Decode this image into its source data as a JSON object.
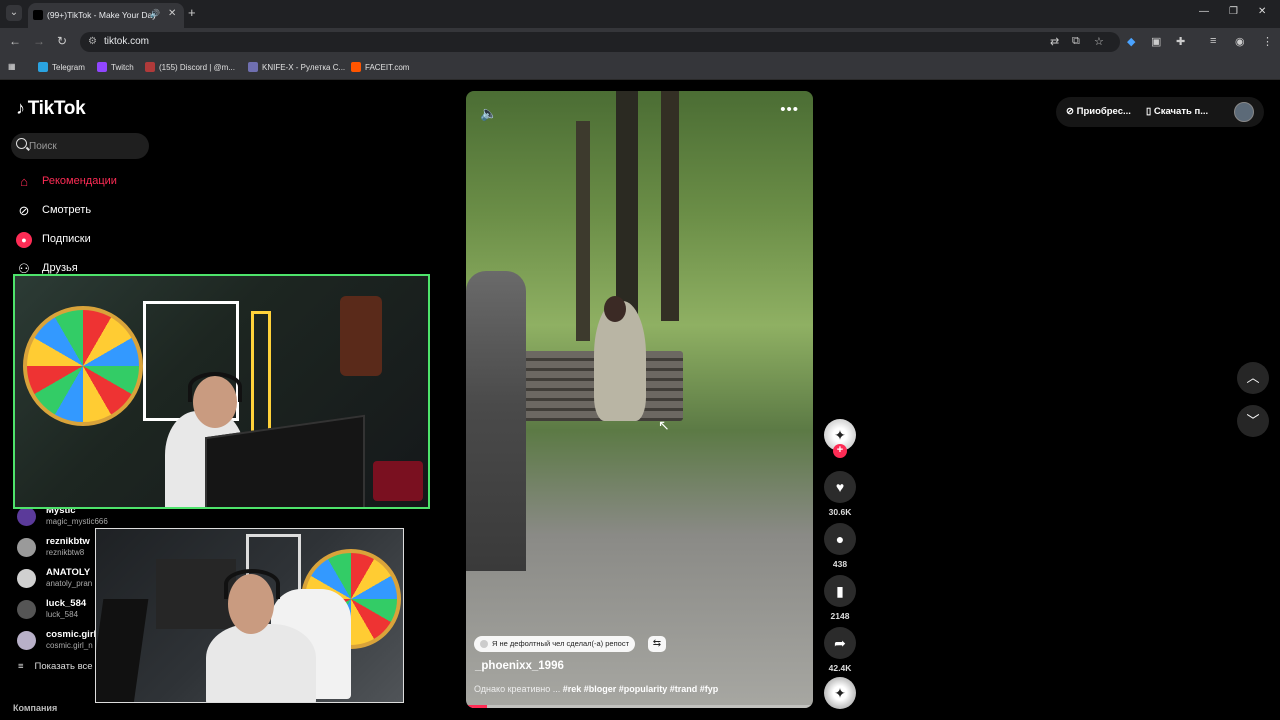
{
  "browser": {
    "tab_title": "(99+)TikTok - Make Your Day",
    "url": "tiktok.com",
    "bookmarks": [
      "Telegram",
      "Twitch",
      "(155) Discord | @m...",
      "KNIFE-X - Рулетка С...",
      "FACEIT.com"
    ],
    "bookmark_colors": [
      "#2aa3e0",
      "#9146ff",
      "#b03a3a",
      "#6f6fb0",
      "#ff5500"
    ]
  },
  "tiktok": {
    "logo": "TikTok",
    "search_placeholder": "Поиск",
    "nav": [
      {
        "label": "Рекомендации",
        "icon": "home-icon"
      },
      {
        "label": "Смотреть",
        "icon": "compass-icon"
      },
      {
        "label": "Подписки",
        "icon": "following-icon"
      },
      {
        "label": "Друзья",
        "icon": "friends-icon"
      }
    ],
    "following": [
      {
        "name": "Mystic",
        "handle": "magic_mystic666"
      },
      {
        "name": "reznikbtw",
        "handle": "reznikbtw8"
      },
      {
        "name": "ANATOLY",
        "handle": "anatoly_pran"
      },
      {
        "name": "luck_584",
        "handle": "luck_584"
      },
      {
        "name": "cosmic.girl",
        "handle": "cosmic.girl_n"
      }
    ],
    "show_all": "Показать все",
    "footer_company": "Компания",
    "accent_color": "#fe2c55"
  },
  "video": {
    "repost_badge": "Я не дефолтный чел сделал(-а) репост",
    "author": "_phoenixx_1996",
    "caption_text": "Однако креативно ... ",
    "hashtags": "#rek #bloger #popularity #trand #fyp",
    "progress_percent": 6
  },
  "actions": {
    "likes": "30.6K",
    "comments": "438",
    "saves": "2148",
    "shares": "42.4K"
  },
  "top_right": {
    "coins": "Приобрес...",
    "download": "Скачать п..."
  }
}
